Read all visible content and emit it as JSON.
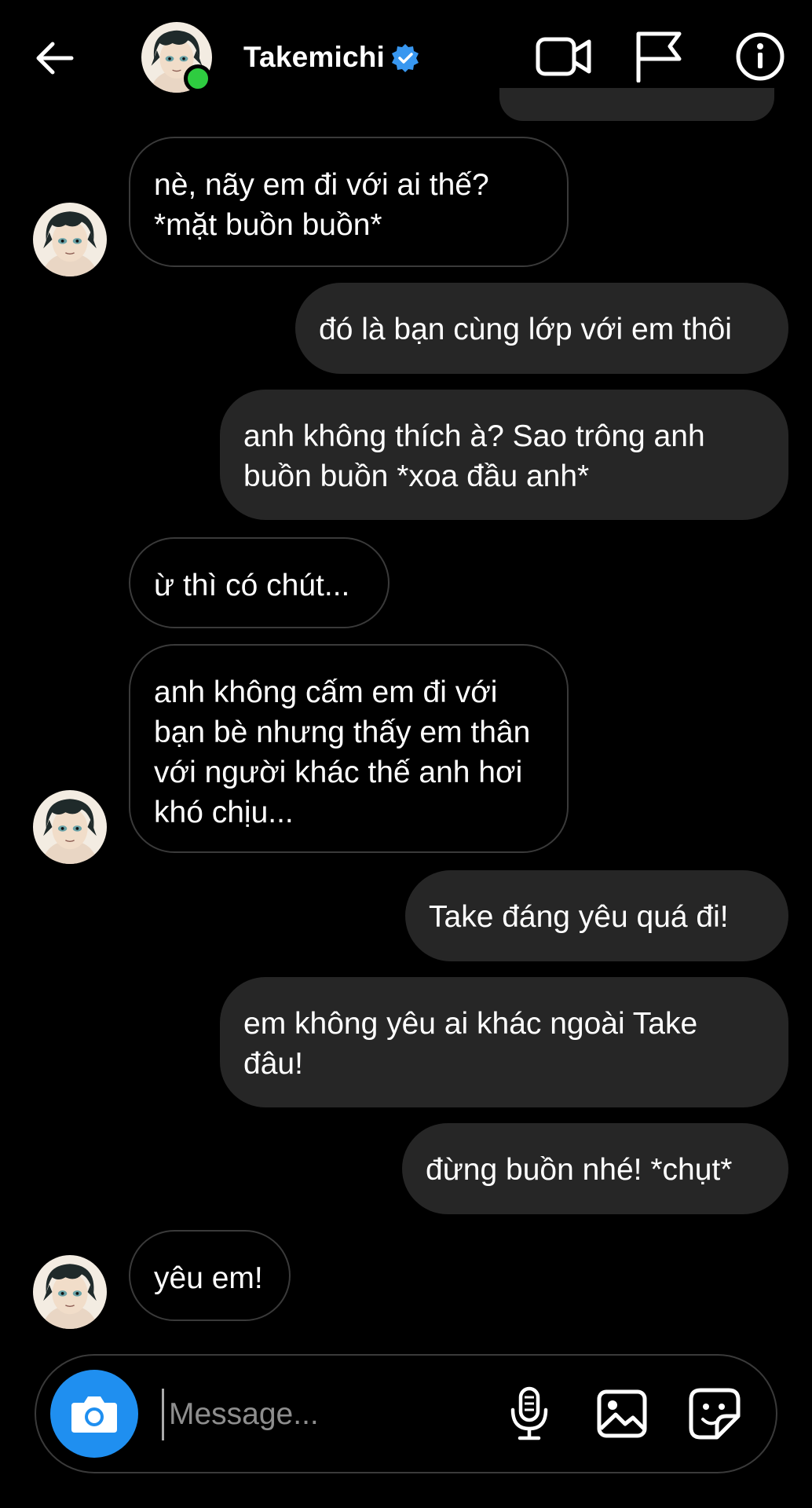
{
  "header": {
    "contact_name": "Takemichi",
    "verified": true,
    "online": true,
    "icons": [
      "back-arrow-icon",
      "video-call-icon",
      "report-flag-icon",
      "info-icon"
    ]
  },
  "messages": [
    {
      "direction": "incoming",
      "show_avatar": true,
      "text": "nè, nãy em đi với ai thế? *mặt buồn buồn*"
    },
    {
      "direction": "outgoing",
      "text": "đó là bạn cùng lớp với em thôi"
    },
    {
      "direction": "outgoing",
      "text": "anh không thích à? Sao trông anh buồn buồn *xoa đầu anh*"
    },
    {
      "direction": "incoming",
      "show_avatar": false,
      "text": "ừ thì có chút..."
    },
    {
      "direction": "incoming",
      "show_avatar": true,
      "text": "anh không cấm em đi với bạn bè nhưng thấy em thân với người khác thế anh hơi khó chịu..."
    },
    {
      "direction": "outgoing",
      "text": "Take đáng yêu quá đi!"
    },
    {
      "direction": "outgoing",
      "text": "em không yêu ai khác ngoài Take đâu!"
    },
    {
      "direction": "outgoing",
      "text": "đừng buồn nhé! *chụt*"
    },
    {
      "direction": "incoming",
      "show_avatar": true,
      "text": "yêu em!"
    }
  ],
  "composer": {
    "placeholder": "Message...",
    "value": "",
    "icons": [
      "camera-icon",
      "microphone-icon",
      "gallery-icon",
      "sticker-icon"
    ]
  },
  "colors": {
    "background": "#000000",
    "outgoing_bubble": "#262626",
    "incoming_border": "#3a3a3a",
    "camera_button": "#1f8ff0",
    "online_dot": "#2ecc40",
    "verified_badge": "#3897f0"
  }
}
